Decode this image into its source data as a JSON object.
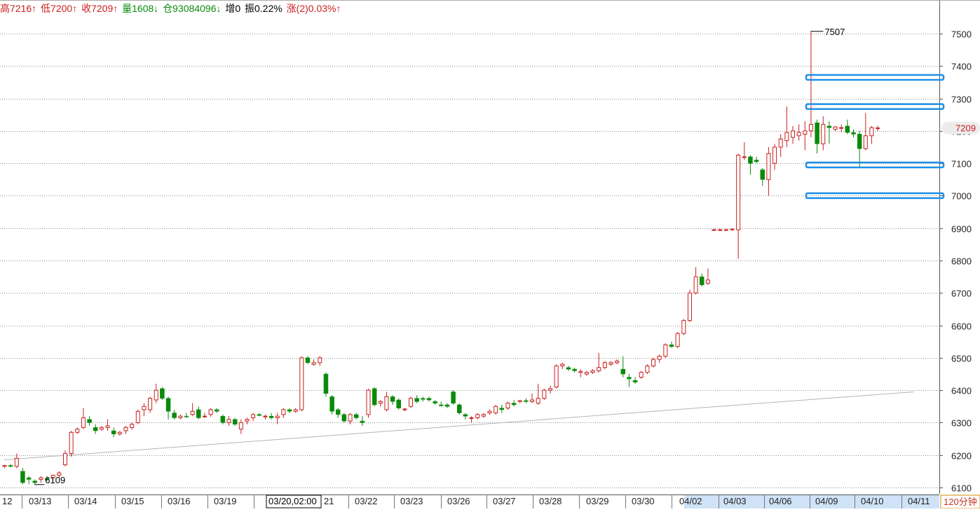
{
  "info_bar": {
    "high": "高7216↑",
    "low": "低7200↑",
    "close": "收7209↑",
    "volume": "量1608↓",
    "open_interest": "仓93084096↓",
    "oi_change": "增0",
    "amplitude": "振0.22%",
    "change": "涨(2)0.03%↑"
  },
  "colors": {
    "up": "#c8201e",
    "down": "#0a8a0a",
    "grid": "#8c8c8c",
    "highlight_box": "#1e8fe6",
    "trendline": "#b4b4b4",
    "axis_hover_bg": "#cfe2f7",
    "price_tag_bg": "#ececec"
  },
  "period_label": "120分钟",
  "crosshair_time_label": "03/20,02:00",
  "current_price_tag": "7209",
  "annotations": {
    "max_label": "7507",
    "min_label": "6109"
  },
  "chart_data": {
    "type": "candlestick",
    "y_axis": {
      "min": 6100,
      "max": 7500,
      "ticks": [
        6100,
        6200,
        6300,
        6400,
        6500,
        6600,
        6700,
        6800,
        6900,
        7000,
        7100,
        7200,
        7300,
        7400,
        7500
      ],
      "position": "right"
    },
    "x_tick_labels": [
      "12",
      "03/13",
      "03/14",
      "03/15",
      "03/16",
      "03/19",
      "03/20,02:00",
      "21",
      "03/22",
      "03/23",
      "03/26",
      "03/27",
      "03/28",
      "03/29",
      "03/30",
      "04/02",
      "04/03",
      "04/06",
      "04/09",
      "04/10",
      "04/11"
    ],
    "grid": true,
    "candles": [
      [
        6165,
        6170,
        6160,
        6168
      ],
      [
        6168,
        6172,
        6163,
        6165
      ],
      [
        6165,
        6205,
        6160,
        6190
      ],
      [
        6150,
        6160,
        6110,
        6115
      ],
      [
        6130,
        6135,
        6110,
        6125
      ],
      [
        6120,
        6125,
        6109,
        6115
      ],
      [
        6125,
        6135,
        6115,
        6130
      ],
      [
        6128,
        6135,
        6120,
        6125
      ],
      [
        6130,
        6140,
        6125,
        6138
      ],
      [
        6138,
        6150,
        6130,
        6145
      ],
      [
        6170,
        6215,
        6165,
        6205
      ],
      [
        6205,
        6275,
        6195,
        6270
      ],
      [
        6270,
        6285,
        6265,
        6280
      ],
      [
        6285,
        6345,
        6280,
        6315
      ],
      [
        6310,
        6320,
        6290,
        6300
      ],
      [
        6285,
        6295,
        6265,
        6275
      ],
      [
        6280,
        6290,
        6275,
        6285
      ],
      [
        6285,
        6310,
        6275,
        6290
      ],
      [
        6275,
        6285,
        6255,
        6265
      ],
      [
        6265,
        6275,
        6260,
        6270
      ],
      [
        6275,
        6290,
        6265,
        6285
      ],
      [
        6285,
        6300,
        6278,
        6295
      ],
      [
        6300,
        6340,
        6295,
        6335
      ],
      [
        6340,
        6360,
        6320,
        6350
      ],
      [
        6340,
        6380,
        6330,
        6375
      ],
      [
        6370,
        6420,
        6360,
        6400
      ],
      [
        6405,
        6410,
        6370,
        6375
      ],
      [
        6375,
        6380,
        6310,
        6335
      ],
      [
        6330,
        6340,
        6310,
        6315
      ],
      [
        6315,
        6325,
        6310,
        6320
      ],
      [
        6320,
        6330,
        6315,
        6318
      ],
      [
        6325,
        6360,
        6320,
        6335
      ],
      [
        6340,
        6350,
        6310,
        6315
      ],
      [
        6318,
        6330,
        6315,
        6320
      ],
      [
        6325,
        6345,
        6318,
        6340
      ],
      [
        6340,
        6345,
        6330,
        6335
      ],
      [
        6320,
        6325,
        6295,
        6300
      ],
      [
        6300,
        6320,
        6290,
        6310
      ],
      [
        6310,
        6315,
        6290,
        6295
      ],
      [
        6280,
        6310,
        6265,
        6300
      ],
      [
        6305,
        6315,
        6295,
        6310
      ],
      [
        6315,
        6330,
        6305,
        6325
      ],
      [
        6325,
        6330,
        6320,
        6322
      ],
      [
        6318,
        6325,
        6310,
        6320
      ],
      [
        6320,
        6330,
        6310,
        6315
      ],
      [
        6315,
        6330,
        6295,
        6320
      ],
      [
        6325,
        6345,
        6315,
        6340
      ],
      [
        6340,
        6345,
        6330,
        6335
      ],
      [
        6335,
        6345,
        6330,
        6340
      ],
      [
        6340,
        6505,
        6335,
        6500
      ],
      [
        6500,
        6505,
        6480,
        6485
      ],
      [
        6480,
        6495,
        6475,
        6485
      ],
      [
        6485,
        6505,
        6475,
        6500
      ],
      [
        6450,
        6455,
        6380,
        6390
      ],
      [
        6380,
        6385,
        6325,
        6335
      ],
      [
        6340,
        6345,
        6315,
        6325
      ],
      [
        6325,
        6330,
        6300,
        6305
      ],
      [
        6305,
        6330,
        6295,
        6325
      ],
      [
        6325,
        6330,
        6310,
        6315
      ],
      [
        6305,
        6320,
        6290,
        6300
      ],
      [
        6325,
        6405,
        6315,
        6400
      ],
      [
        6405,
        6410,
        6350,
        6355
      ],
      [
        6360,
        6370,
        6350,
        6365
      ],
      [
        6340,
        6395,
        6335,
        6380
      ],
      [
        6380,
        6385,
        6355,
        6365
      ],
      [
        6370,
        6375,
        6340,
        6345
      ],
      [
        6340,
        6345,
        6335,
        6342
      ],
      [
        6350,
        6380,
        6345,
        6375
      ],
      [
        6375,
        6385,
        6360,
        6365
      ],
      [
        6375,
        6380,
        6365,
        6372
      ],
      [
        6375,
        6380,
        6365,
        6370
      ],
      [
        6365,
        6370,
        6355,
        6360
      ],
      [
        6355,
        6365,
        6350,
        6352
      ],
      [
        6355,
        6360,
        6345,
        6350
      ],
      [
        6395,
        6400,
        6355,
        6360
      ],
      [
        6355,
        6360,
        6325,
        6330
      ],
      [
        6325,
        6330,
        6310,
        6320
      ],
      [
        6315,
        6320,
        6300,
        6315
      ],
      [
        6315,
        6330,
        6310,
        6325
      ],
      [
        6320,
        6330,
        6315,
        6325
      ],
      [
        6330,
        6340,
        6325,
        6335
      ],
      [
        6330,
        6355,
        6325,
        6350
      ],
      [
        6345,
        6355,
        6330,
        6340
      ],
      [
        6345,
        6365,
        6340,
        6360
      ],
      [
        6360,
        6370,
        6350,
        6355
      ],
      [
        6365,
        6370,
        6360,
        6368
      ],
      [
        6368,
        6375,
        6360,
        6365
      ],
      [
        6365,
        6390,
        6360,
        6370
      ],
      [
        6360,
        6420,
        6355,
        6375
      ],
      [
        6375,
        6405,
        6370,
        6400
      ],
      [
        6400,
        6415,
        6390,
        6405
      ],
      [
        6410,
        6480,
        6405,
        6475
      ],
      [
        6475,
        6485,
        6465,
        6480
      ],
      [
        6470,
        6475,
        6460,
        6465
      ],
      [
        6465,
        6470,
        6455,
        6460
      ],
      [
        6455,
        6465,
        6440,
        6458
      ],
      [
        6450,
        6460,
        6445,
        6455
      ],
      [
        6455,
        6465,
        6450,
        6460
      ],
      [
        6460,
        6515,
        6455,
        6470
      ],
      [
        6470,
        6490,
        6465,
        6485
      ],
      [
        6480,
        6490,
        6475,
        6485
      ],
      [
        6485,
        6495,
        6480,
        6490
      ],
      [
        6465,
        6505,
        6440,
        6450
      ],
      [
        6440,
        6450,
        6410,
        6435
      ],
      [
        6430,
        6440,
        6420,
        6425
      ],
      [
        6440,
        6460,
        6435,
        6455
      ],
      [
        6455,
        6480,
        6450,
        6475
      ],
      [
        6475,
        6500,
        6470,
        6495
      ],
      [
        6495,
        6510,
        6485,
        6505
      ],
      [
        6505,
        6545,
        6500,
        6540
      ],
      [
        6540,
        6550,
        6530,
        6535
      ],
      [
        6535,
        6580,
        6530,
        6575
      ],
      [
        6575,
        6620,
        6570,
        6615
      ],
      [
        6615,
        6710,
        6610,
        6700
      ],
      [
        6700,
        6780,
        6695,
        6750
      ],
      [
        6750,
        6760,
        6720,
        6725
      ],
      [
        6730,
        6775,
        6725,
        6740
      ],
      [
        6895,
        6898,
        6892,
        6895
      ],
      [
        6895,
        6898,
        6892,
        6895
      ],
      [
        6895,
        6898,
        6892,
        6895
      ],
      [
        6895,
        6900,
        6892,
        6897
      ],
      [
        6895,
        7130,
        6805,
        7125
      ],
      [
        7120,
        7165,
        7110,
        7120
      ],
      [
        7120,
        7125,
        7065,
        7100
      ],
      [
        7110,
        7120,
        7100,
        7105
      ],
      [
        7080,
        7085,
        7030,
        7050
      ],
      [
        7050,
        7150,
        7000,
        7130
      ],
      [
        7100,
        7160,
        7080,
        7150
      ],
      [
        7150,
        7190,
        7120,
        7175
      ],
      [
        7170,
        7275,
        7150,
        7195
      ],
      [
        7180,
        7215,
        7160,
        7200
      ],
      [
        7185,
        7220,
        7170,
        7195
      ],
      [
        7190,
        7230,
        7140,
        7200
      ],
      [
        7200,
        7507,
        7180,
        7220
      ],
      [
        7225,
        7235,
        7130,
        7160
      ],
      [
        7160,
        7245,
        7140,
        7220
      ],
      [
        7215,
        7230,
        7160,
        7210
      ],
      [
        7205,
        7215,
        7200,
        7212
      ],
      [
        7210,
        7220,
        7195,
        7210
      ],
      [
        7215,
        7235,
        7190,
        7195
      ],
      [
        7195,
        7205,
        7180,
        7190
      ],
      [
        7190,
        7200,
        7085,
        7145
      ],
      [
        7145,
        7255,
        7140,
        7185
      ],
      [
        7185,
        7215,
        7160,
        7210
      ],
      [
        7208,
        7216,
        7200,
        7209
      ]
    ],
    "trendline": [
      [
        0,
        6185
      ],
      [
        150,
        6395
      ]
    ],
    "highlight_levels": [
      7365,
      7275,
      7095,
      7000
    ]
  }
}
